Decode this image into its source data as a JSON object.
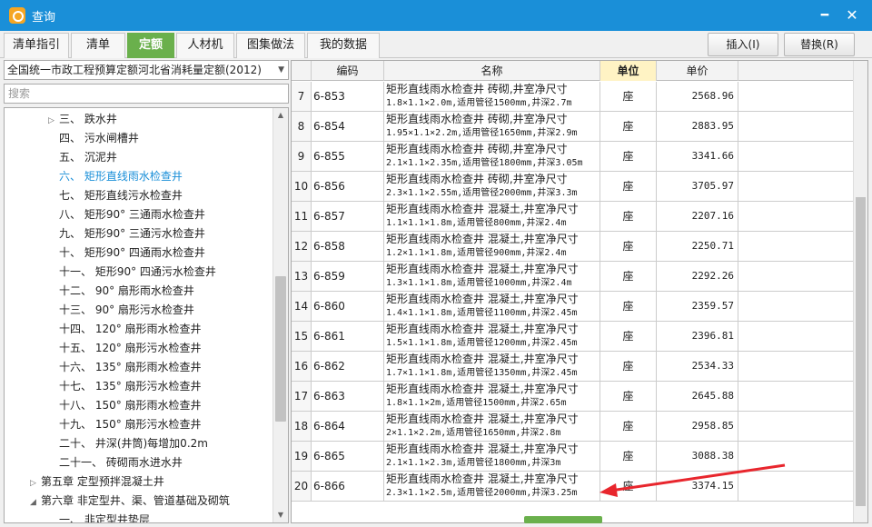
{
  "window": {
    "title": "查询",
    "minimize": "━",
    "close": "✕"
  },
  "tabs": [
    {
      "label": "清单指引"
    },
    {
      "label": "清单"
    },
    {
      "label": "定额",
      "active": true
    },
    {
      "label": "人材机"
    },
    {
      "label": "图集做法"
    },
    {
      "label": "我的数据"
    }
  ],
  "buttons": {
    "insert": "插入(I)",
    "replace": "替换(R)"
  },
  "left": {
    "library": "全国统一市政工程预算定额河北省消耗量定额(2012)",
    "search_placeholder": "搜索",
    "tree": [
      {
        "label": "三、 跌水井",
        "indent": 1,
        "expander": "▷"
      },
      {
        "label": "四、 污水闸槽井",
        "indent": 1
      },
      {
        "label": "五、 沉泥井",
        "indent": 1
      },
      {
        "label": "六、 矩形直线雨水检查井",
        "indent": 1,
        "selected": true
      },
      {
        "label": "七、 矩形直线污水检查井",
        "indent": 1
      },
      {
        "label": "八、 矩形90° 三通雨水检查井",
        "indent": 1
      },
      {
        "label": "九、 矩形90° 三通污水检查井",
        "indent": 1
      },
      {
        "label": "十、 矩形90° 四通雨水检查井",
        "indent": 1
      },
      {
        "label": "十一、 矩形90° 四通污水检查井",
        "indent": 1
      },
      {
        "label": "十二、 90° 扇形雨水检查井",
        "indent": 1
      },
      {
        "label": "十三、 90° 扇形污水检查井",
        "indent": 1
      },
      {
        "label": "十四、 120° 扇形雨水检查井",
        "indent": 1
      },
      {
        "label": "十五、 120° 扇形污水检查井",
        "indent": 1
      },
      {
        "label": "十六、 135° 扇形雨水检查井",
        "indent": 1
      },
      {
        "label": "十七、 135° 扇形污水检查井",
        "indent": 1
      },
      {
        "label": "十八、 150° 扇形雨水检查井",
        "indent": 1
      },
      {
        "label": "十九、 150° 扇形污水检查井",
        "indent": 1
      },
      {
        "label": "二十、 井深(井筒)每增加0.2m",
        "indent": 1
      },
      {
        "label": "二十一、 砖砌雨水进水井",
        "indent": 1
      },
      {
        "label": "第五章 定型预拌混凝土井",
        "indent": 0,
        "expander": "▷"
      },
      {
        "label": "第六章 非定型井、渠、管道基础及砌筑",
        "indent": 0,
        "expander": "◢"
      },
      {
        "label": "一、 非定型井垫层",
        "indent": 1
      }
    ]
  },
  "grid": {
    "headers": {
      "code": "编码",
      "name": "名称",
      "unit": "单位",
      "price": "单价"
    },
    "rows": [
      {
        "idx": "7",
        "code": "6-853",
        "name1": "矩形直线雨水检查井 砖砌,井室净尺寸",
        "name2": "1.8×1.1×2.0m,适用管径1500mm,井深2.7m",
        "unit": "座",
        "price": "2568.96"
      },
      {
        "idx": "8",
        "code": "6-854",
        "name1": "矩形直线雨水检查井 砖砌,井室净尺寸",
        "name2": "1.95×1.1×2.2m,适用管径1650mm,井深2.9m",
        "unit": "座",
        "price": "2883.95"
      },
      {
        "idx": "9",
        "code": "6-855",
        "name1": "矩形直线雨水检查井 砖砌,井室净尺寸",
        "name2": "2.1×1.1×2.35m,适用管径1800mm,井深3.05m",
        "unit": "座",
        "price": "3341.66"
      },
      {
        "idx": "10",
        "code": "6-856",
        "name1": "矩形直线雨水检查井 砖砌,井室净尺寸",
        "name2": "2.3×1.1×2.55m,适用管径2000mm,井深3.3m",
        "unit": "座",
        "price": "3705.97"
      },
      {
        "idx": "11",
        "code": "6-857",
        "name1": "矩形直线雨水检查井 混凝土,井室净尺寸",
        "name2": "1.1×1.1×1.8m,适用管径800mm,井深2.4m",
        "unit": "座",
        "price": "2207.16"
      },
      {
        "idx": "12",
        "code": "6-858",
        "name1": "矩形直线雨水检查井 混凝土,井室净尺寸",
        "name2": "1.2×1.1×1.8m,适用管径900mm,井深2.4m",
        "unit": "座",
        "price": "2250.71"
      },
      {
        "idx": "13",
        "code": "6-859",
        "name1": "矩形直线雨水检查井 混凝土,井室净尺寸",
        "name2": "1.3×1.1×1.8m,适用管径1000mm,井深2.4m",
        "unit": "座",
        "price": "2292.26"
      },
      {
        "idx": "14",
        "code": "6-860",
        "name1": "矩形直线雨水检查井 混凝土,井室净尺寸",
        "name2": "1.4×1.1×1.8m,适用管径1100mm,井深2.45m",
        "unit": "座",
        "price": "2359.57"
      },
      {
        "idx": "15",
        "code": "6-861",
        "name1": "矩形直线雨水检查井 混凝土,井室净尺寸",
        "name2": "1.5×1.1×1.8m,适用管径1200mm,井深2.45m",
        "unit": "座",
        "price": "2396.81"
      },
      {
        "idx": "16",
        "code": "6-862",
        "name1": "矩形直线雨水检查井 混凝土,井室净尺寸",
        "name2": "1.7×1.1×1.8m,适用管径1350mm,井深2.45m",
        "unit": "座",
        "price": "2534.33"
      },
      {
        "idx": "17",
        "code": "6-863",
        "name1": "矩形直线雨水检查井 混凝土,井室净尺寸",
        "name2": "1.8×1.1×2m,适用管径1500mm,井深2.65m",
        "unit": "座",
        "price": "2645.88"
      },
      {
        "idx": "18",
        "code": "6-864",
        "name1": "矩形直线雨水检查井 混凝土,井室净尺寸",
        "name2": "2×1.1×2.2m,适用管径1650mm,井深2.8m",
        "unit": "座",
        "price": "2958.85"
      },
      {
        "idx": "19",
        "code": "6-865",
        "name1": "矩形直线雨水检查井 混凝土,井室净尺寸",
        "name2": "2.1×1.1×2.3m,适用管径1800mm,井深3m",
        "unit": "座",
        "price": "3088.38"
      },
      {
        "idx": "20",
        "code": "6-866",
        "name1": "矩形直线雨水检查井 混凝土,井室净尺寸",
        "name2": "2.3×1.1×2.5m,适用管径2000mm,井深3.25m",
        "unit": "座",
        "price": "3374.15"
      }
    ]
  },
  "colors": {
    "titlebar": "#1a8fd8",
    "active_tab": "#6ab04c",
    "selected_tree": "#1a8fd8",
    "annotation_arrow": "#e8262d"
  }
}
